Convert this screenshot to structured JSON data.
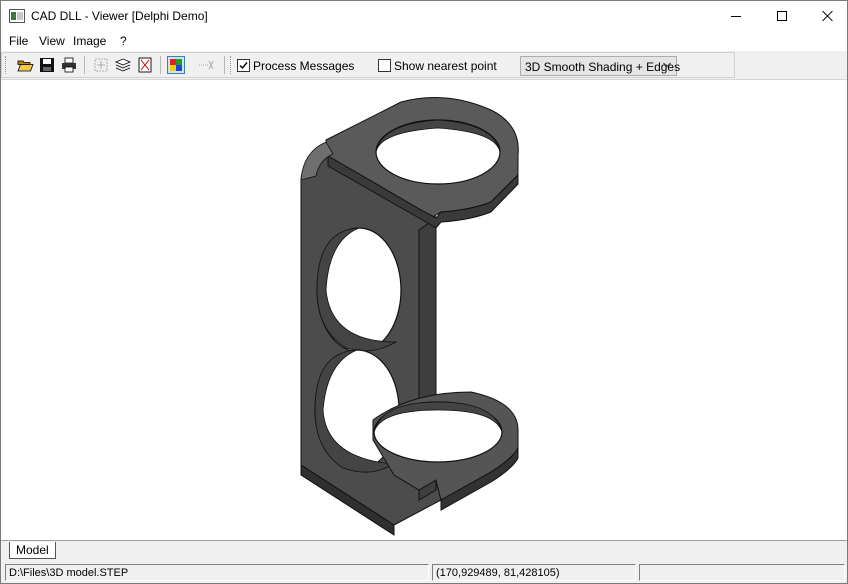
{
  "window": {
    "title": "CAD DLL - Viewer [Delphi Demo]"
  },
  "menu": [
    "File",
    "View",
    "Image",
    "?"
  ],
  "toolbar": {
    "process_messages_label": "Process Messages",
    "process_messages_checked": true,
    "show_nearest_point_label": "Show nearest point",
    "show_nearest_point_checked": false,
    "render_mode": "3D Smooth Shading + Edges"
  },
  "tabs": [
    "Model"
  ],
  "status": {
    "file_path": "D:\\Files\\3D model.STEP",
    "coordinates": "(170,929489, 81,428105)"
  },
  "colors": {
    "model_fill": "#505050",
    "model_highlight": "#7a7a7a",
    "model_shadow": "#2e2e2e",
    "viewport_bg": "#ffffff"
  }
}
